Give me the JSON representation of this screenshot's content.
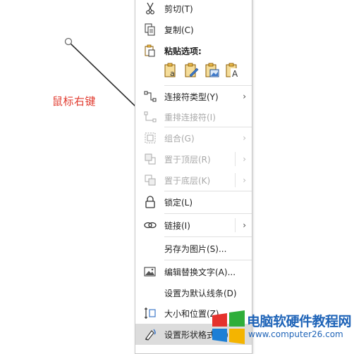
{
  "annotation": {
    "label": "鼠标右键"
  },
  "menu": {
    "items": [
      {
        "label": "剪切(T)",
        "icon": "scissors-icon",
        "disabled": false
      },
      {
        "label": "复制(C)",
        "icon": "copy-icon",
        "disabled": false
      },
      {
        "label": "粘贴选项:",
        "icon": "clipboard-icon",
        "disabled": false
      },
      {
        "label": "连接符类型(Y)",
        "icon": "connector-icon",
        "disabled": false,
        "submenu": true
      },
      {
        "label": "重排连接符(I)",
        "icon": "reroute-connector-icon",
        "disabled": true
      },
      {
        "label": "组合(G)",
        "icon": "group-icon",
        "disabled": true,
        "submenu": true
      },
      {
        "label": "置于顶层(R)",
        "icon": "bring-to-front-icon",
        "disabled": true,
        "submenu": true
      },
      {
        "label": "置于底层(K)",
        "icon": "send-to-back-icon",
        "disabled": true,
        "submenu": true
      },
      {
        "label": "锁定(L)",
        "icon": "lock-icon",
        "disabled": false
      },
      {
        "label": "链接(I)",
        "icon": "link-icon",
        "disabled": false,
        "submenu": true
      },
      {
        "label": "另存为图片(S)...",
        "icon": "",
        "disabled": false
      },
      {
        "label": "编辑替换文字(A)...",
        "icon": "alt-text-icon",
        "disabled": false
      },
      {
        "label": "设置为默认线条(D)",
        "icon": "",
        "disabled": false
      },
      {
        "label": "大小和位置(Z)...",
        "icon": "size-position-icon",
        "disabled": false
      },
      {
        "label": "设置形状格式(O)...",
        "icon": "format-shape-icon",
        "disabled": false,
        "selected": true
      }
    ],
    "paste_options": [
      "paste-keep-text-icon",
      "paste-format-icon",
      "paste-picture-icon",
      "paste-text-only-icon"
    ]
  },
  "watermark": {
    "title": "电脑软硬件教程网",
    "url": "www.computer26.com",
    "colors": {
      "red": "#e5322d",
      "green": "#2fae3a",
      "blue": "#1d7fd6",
      "yellow": "#f4b400"
    }
  }
}
